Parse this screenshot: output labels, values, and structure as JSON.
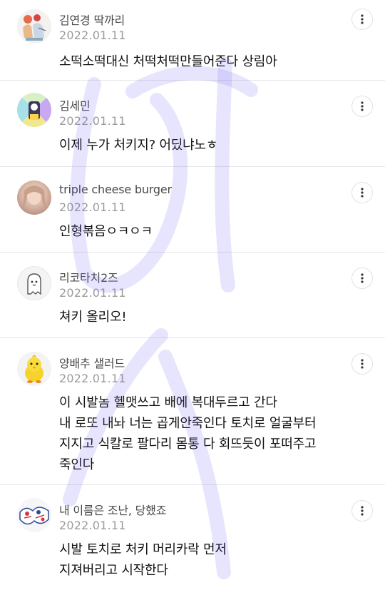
{
  "comments": [
    {
      "author": "김연경 딱까리",
      "date": "2022.01.11",
      "lines": [
        "소떡소떡대신 처떡처떡만들어준다 상림아"
      ],
      "avatar": "avatar-sketch-icon",
      "more_icon": "more-vertical-icon"
    },
    {
      "author": "김세민",
      "date": "2022.01.11",
      "lines": [
        "이제 누가 처키지? 어딨냐노ㅎ"
      ],
      "avatar": "avatar-cartoon-icon",
      "more_icon": "more-vertical-icon"
    },
    {
      "author": "triple cheese burger",
      "date": "2022.01.11",
      "lines": [
        "인형볶음ㅇㅋㅇㅋ"
      ],
      "avatar": "avatar-photo-icon",
      "more_icon": "more-vertical-icon"
    },
    {
      "author": "리코타치2즈",
      "date": "2022.01.11",
      "lines": [
        "쳐키 올리오!"
      ],
      "avatar": "avatar-ghost-icon",
      "more_icon": "more-vertical-icon"
    },
    {
      "author": "양배추 샐러드",
      "date": "2022.01.11",
      "lines": [
        "이 시발놈 헬맷쓰고 배에 복대두르고 간다",
        "내 로또 내놔 너는 곱게안죽인다 토치로 얼굴부터",
        "지지고 식칼로 팔다리 몸통 다 회뜨듯이 포떠주고",
        "죽인다"
      ],
      "avatar": "avatar-chick-icon",
      "more_icon": "more-vertical-icon"
    },
    {
      "author": "내 이름은 조난, 당했죠",
      "date": "2022.01.11",
      "lines": [
        "시발 토치로 처키 머리카락 먼저",
        "지져버리고 시작한다"
      ],
      "avatar": "avatar-illustration-icon",
      "more_icon": "more-vertical-icon"
    }
  ],
  "colors": {
    "text": "#111111",
    "author": "#4a4a4a",
    "date": "#9b9b9b",
    "divider": "#e6e6e6",
    "watermark": "#6a5cf0"
  }
}
